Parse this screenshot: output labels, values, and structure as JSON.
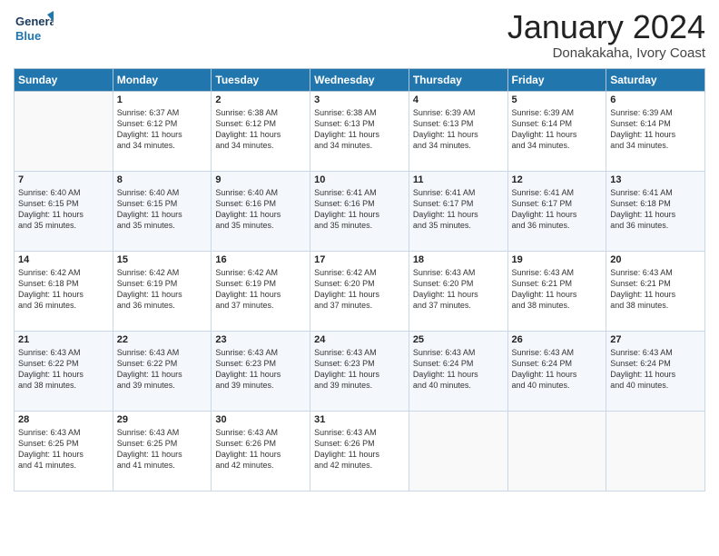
{
  "logo": {
    "general": "General",
    "blue": "Blue"
  },
  "title": "January 2024",
  "subtitle": "Donakakaha, Ivory Coast",
  "days_of_week": [
    "Sunday",
    "Monday",
    "Tuesday",
    "Wednesday",
    "Thursday",
    "Friday",
    "Saturday"
  ],
  "weeks": [
    [
      {
        "day": "",
        "lines": []
      },
      {
        "day": "1",
        "lines": [
          "Sunrise: 6:37 AM",
          "Sunset: 6:12 PM",
          "Daylight: 11 hours",
          "and 34 minutes."
        ]
      },
      {
        "day": "2",
        "lines": [
          "Sunrise: 6:38 AM",
          "Sunset: 6:12 PM",
          "Daylight: 11 hours",
          "and 34 minutes."
        ]
      },
      {
        "day": "3",
        "lines": [
          "Sunrise: 6:38 AM",
          "Sunset: 6:13 PM",
          "Daylight: 11 hours",
          "and 34 minutes."
        ]
      },
      {
        "day": "4",
        "lines": [
          "Sunrise: 6:39 AM",
          "Sunset: 6:13 PM",
          "Daylight: 11 hours",
          "and 34 minutes."
        ]
      },
      {
        "day": "5",
        "lines": [
          "Sunrise: 6:39 AM",
          "Sunset: 6:14 PM",
          "Daylight: 11 hours",
          "and 34 minutes."
        ]
      },
      {
        "day": "6",
        "lines": [
          "Sunrise: 6:39 AM",
          "Sunset: 6:14 PM",
          "Daylight: 11 hours",
          "and 34 minutes."
        ]
      }
    ],
    [
      {
        "day": "7",
        "lines": [
          "Sunrise: 6:40 AM",
          "Sunset: 6:15 PM",
          "Daylight: 11 hours",
          "and 35 minutes."
        ]
      },
      {
        "day": "8",
        "lines": [
          "Sunrise: 6:40 AM",
          "Sunset: 6:15 PM",
          "Daylight: 11 hours",
          "and 35 minutes."
        ]
      },
      {
        "day": "9",
        "lines": [
          "Sunrise: 6:40 AM",
          "Sunset: 6:16 PM",
          "Daylight: 11 hours",
          "and 35 minutes."
        ]
      },
      {
        "day": "10",
        "lines": [
          "Sunrise: 6:41 AM",
          "Sunset: 6:16 PM",
          "Daylight: 11 hours",
          "and 35 minutes."
        ]
      },
      {
        "day": "11",
        "lines": [
          "Sunrise: 6:41 AM",
          "Sunset: 6:17 PM",
          "Daylight: 11 hours",
          "and 35 minutes."
        ]
      },
      {
        "day": "12",
        "lines": [
          "Sunrise: 6:41 AM",
          "Sunset: 6:17 PM",
          "Daylight: 11 hours",
          "and 36 minutes."
        ]
      },
      {
        "day": "13",
        "lines": [
          "Sunrise: 6:41 AM",
          "Sunset: 6:18 PM",
          "Daylight: 11 hours",
          "and 36 minutes."
        ]
      }
    ],
    [
      {
        "day": "14",
        "lines": [
          "Sunrise: 6:42 AM",
          "Sunset: 6:18 PM",
          "Daylight: 11 hours",
          "and 36 minutes."
        ]
      },
      {
        "day": "15",
        "lines": [
          "Sunrise: 6:42 AM",
          "Sunset: 6:19 PM",
          "Daylight: 11 hours",
          "and 36 minutes."
        ]
      },
      {
        "day": "16",
        "lines": [
          "Sunrise: 6:42 AM",
          "Sunset: 6:19 PM",
          "Daylight: 11 hours",
          "and 37 minutes."
        ]
      },
      {
        "day": "17",
        "lines": [
          "Sunrise: 6:42 AM",
          "Sunset: 6:20 PM",
          "Daylight: 11 hours",
          "and 37 minutes."
        ]
      },
      {
        "day": "18",
        "lines": [
          "Sunrise: 6:43 AM",
          "Sunset: 6:20 PM",
          "Daylight: 11 hours",
          "and 37 minutes."
        ]
      },
      {
        "day": "19",
        "lines": [
          "Sunrise: 6:43 AM",
          "Sunset: 6:21 PM",
          "Daylight: 11 hours",
          "and 38 minutes."
        ]
      },
      {
        "day": "20",
        "lines": [
          "Sunrise: 6:43 AM",
          "Sunset: 6:21 PM",
          "Daylight: 11 hours",
          "and 38 minutes."
        ]
      }
    ],
    [
      {
        "day": "21",
        "lines": [
          "Sunrise: 6:43 AM",
          "Sunset: 6:22 PM",
          "Daylight: 11 hours",
          "and 38 minutes."
        ]
      },
      {
        "day": "22",
        "lines": [
          "Sunrise: 6:43 AM",
          "Sunset: 6:22 PM",
          "Daylight: 11 hours",
          "and 39 minutes."
        ]
      },
      {
        "day": "23",
        "lines": [
          "Sunrise: 6:43 AM",
          "Sunset: 6:23 PM",
          "Daylight: 11 hours",
          "and 39 minutes."
        ]
      },
      {
        "day": "24",
        "lines": [
          "Sunrise: 6:43 AM",
          "Sunset: 6:23 PM",
          "Daylight: 11 hours",
          "and 39 minutes."
        ]
      },
      {
        "day": "25",
        "lines": [
          "Sunrise: 6:43 AM",
          "Sunset: 6:24 PM",
          "Daylight: 11 hours",
          "and 40 minutes."
        ]
      },
      {
        "day": "26",
        "lines": [
          "Sunrise: 6:43 AM",
          "Sunset: 6:24 PM",
          "Daylight: 11 hours",
          "and 40 minutes."
        ]
      },
      {
        "day": "27",
        "lines": [
          "Sunrise: 6:43 AM",
          "Sunset: 6:24 PM",
          "Daylight: 11 hours",
          "and 40 minutes."
        ]
      }
    ],
    [
      {
        "day": "28",
        "lines": [
          "Sunrise: 6:43 AM",
          "Sunset: 6:25 PM",
          "Daylight: 11 hours",
          "and 41 minutes."
        ]
      },
      {
        "day": "29",
        "lines": [
          "Sunrise: 6:43 AM",
          "Sunset: 6:25 PM",
          "Daylight: 11 hours",
          "and 41 minutes."
        ]
      },
      {
        "day": "30",
        "lines": [
          "Sunrise: 6:43 AM",
          "Sunset: 6:26 PM",
          "Daylight: 11 hours",
          "and 42 minutes."
        ]
      },
      {
        "day": "31",
        "lines": [
          "Sunrise: 6:43 AM",
          "Sunset: 6:26 PM",
          "Daylight: 11 hours",
          "and 42 minutes."
        ]
      },
      {
        "day": "",
        "lines": []
      },
      {
        "day": "",
        "lines": []
      },
      {
        "day": "",
        "lines": []
      }
    ]
  ]
}
